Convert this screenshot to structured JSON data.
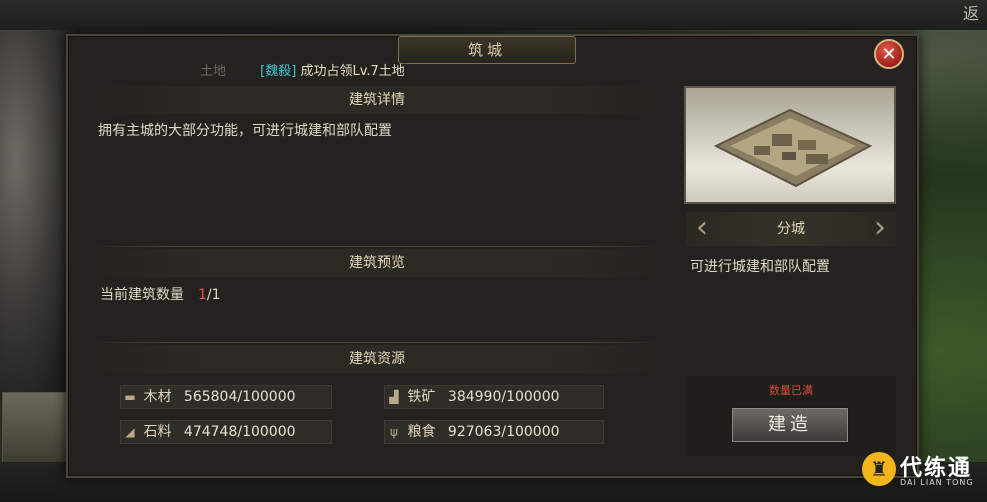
{
  "window": {
    "title": "筑城",
    "close_glyph": "✕",
    "top_right_text": "返"
  },
  "notice": {
    "faded_text": "土地",
    "faction": "[魏殺]",
    "message": "成功占领Lv.7土地"
  },
  "details": {
    "heading": "建筑详情",
    "description": "拥有主城的大部分功能，可进行城建和部队配置"
  },
  "preview": {
    "heading": "建筑预览",
    "count_label": "当前建筑数量",
    "count_current": "1",
    "count_total": "/1"
  },
  "resources": {
    "heading": "建筑资源",
    "items": [
      {
        "icon": "wood-icon",
        "name": "木材",
        "value": "565804/100000"
      },
      {
        "icon": "iron-icon",
        "name": "铁矿",
        "value": "384990/100000"
      },
      {
        "icon": "stone-icon",
        "name": "石料",
        "value": "474748/100000"
      },
      {
        "icon": "grain-icon",
        "name": "粮食",
        "value": "927063/100000"
      }
    ]
  },
  "building": {
    "variant_name": "分城",
    "variant_desc": "可进行城建和部队配置",
    "prev_glyph": "‹",
    "next_glyph": "›",
    "quota_status": "数量已满",
    "build_label": "建造"
  },
  "watermark": {
    "name": "代练通",
    "sub": "DAI LIAN TONG"
  },
  "colors": {
    "accent_red": "#d64a3c",
    "faction_cyan": "#3fc6d6",
    "gold": "#f2b51c"
  }
}
